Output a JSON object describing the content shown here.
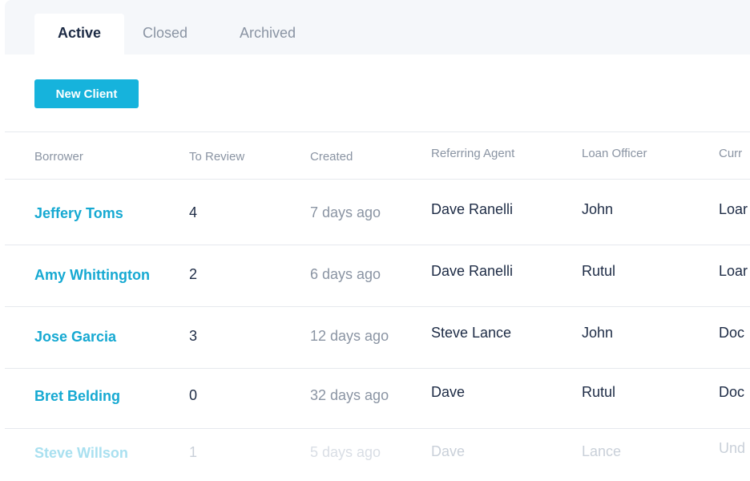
{
  "tabs": [
    {
      "label": "Active",
      "active": true
    },
    {
      "label": "Closed",
      "active": false
    },
    {
      "label": "Archived",
      "active": false
    }
  ],
  "toolbar": {
    "new_client_label": "New Client"
  },
  "table": {
    "columns": [
      "Borrower",
      "To Review",
      "Created",
      "Referring Agent",
      "Loan Officer",
      "Curr"
    ],
    "rows": [
      {
        "borrower": "Jeffery Toms",
        "to_review": "4",
        "created": "7 days ago",
        "agent": "Dave Ranelli",
        "officer": "John",
        "current": "Loar"
      },
      {
        "borrower": "Amy Whittington",
        "to_review": "2",
        "created": "6 days ago",
        "agent": "Dave Ranelli",
        "officer": "Rutul",
        "current": "Loar"
      },
      {
        "borrower": "Jose Garcia",
        "to_review": "3",
        "created": "12 days ago",
        "agent": "Steve Lance",
        "officer": "John",
        "current": "Doc"
      },
      {
        "borrower": "Bret Belding",
        "to_review": "0",
        "created": "32 days ago",
        "agent": "Dave",
        "officer": "Rutul",
        "current": "Doc"
      },
      {
        "borrower": "Steve Willson",
        "to_review": "1",
        "created": "5 days ago",
        "agent": "Dave",
        "officer": "Lance",
        "current": "Und"
      }
    ]
  },
  "colors": {
    "accent": "#16b3dc",
    "link": "#16a9d2",
    "text": "#1d2b45",
    "muted": "#8a94a3"
  }
}
